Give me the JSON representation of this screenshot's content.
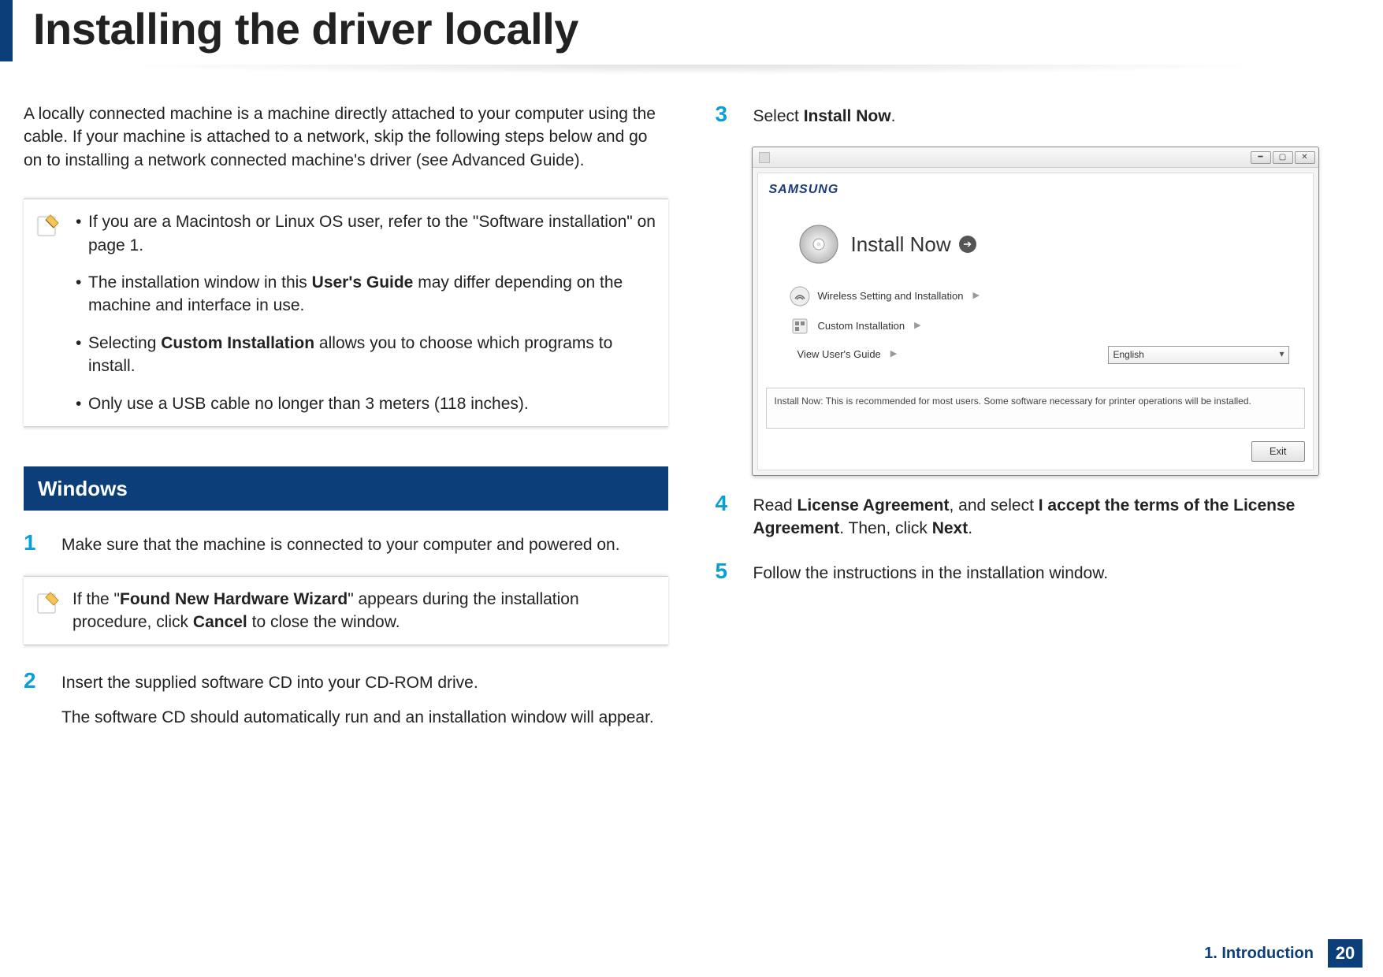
{
  "title": "Installing the driver locally",
  "intro": "A locally connected machine is a machine directly attached to your computer using the cable. If your machine is attached to a network, skip the following steps below and go on to installing a network connected machine's driver (see Advanced Guide).",
  "note1": {
    "bullets": [
      {
        "pre": "If you are a Macintosh or Linux OS user, refer to the \"Software installation\" on page 1."
      },
      {
        "pre": "The installation window in this ",
        "bold": "User's Guide",
        "post": " may differ depending on the machine and interface in use."
      },
      {
        "pre": "Selecting ",
        "bold": "Custom Installation",
        "post": " allows you to choose which programs to install."
      },
      {
        "pre": "Only use a USB cable no longer than 3 meters (118 inches)."
      }
    ]
  },
  "sectionHeading": "Windows",
  "steps": {
    "s1": {
      "num": "1",
      "text": "Make sure that the machine is connected to your computer and powered on."
    },
    "s2": {
      "num": "2",
      "line1": "Insert the supplied software CD into your CD-ROM drive.",
      "line2": "The software CD should automatically run and an installation window will appear."
    },
    "s3": {
      "num": "3",
      "pre": "Select ",
      "bold": "Install Now",
      "post": "."
    },
    "s4": {
      "num": "4",
      "pre": "Read ",
      "b1": "License Agreement",
      "mid1": ", and select ",
      "b2": "I accept the terms of the License Agreement",
      "mid2": ". Then, click ",
      "b3": "Next",
      "post": "."
    },
    "s5": {
      "num": "5",
      "text": "Follow the instructions in the installation window."
    }
  },
  "note2": {
    "pre": "If the \"",
    "b1": "Found New Hardware Wizard",
    "mid": "\" appears during the installation procedure, click ",
    "b2": "Cancel",
    "post": " to close the window."
  },
  "installer": {
    "brand": "SAMSUNG",
    "primary": "Install Now",
    "rows": {
      "wireless": "Wireless Setting and Installation",
      "custom": "Custom Installation",
      "guide": "View User's Guide"
    },
    "language": "English",
    "info": "Install Now: This is recommended for most users. Some software necessary for printer operations will be installed.",
    "exit": "Exit"
  },
  "footer": {
    "section": "1. Introduction",
    "page": "20"
  }
}
